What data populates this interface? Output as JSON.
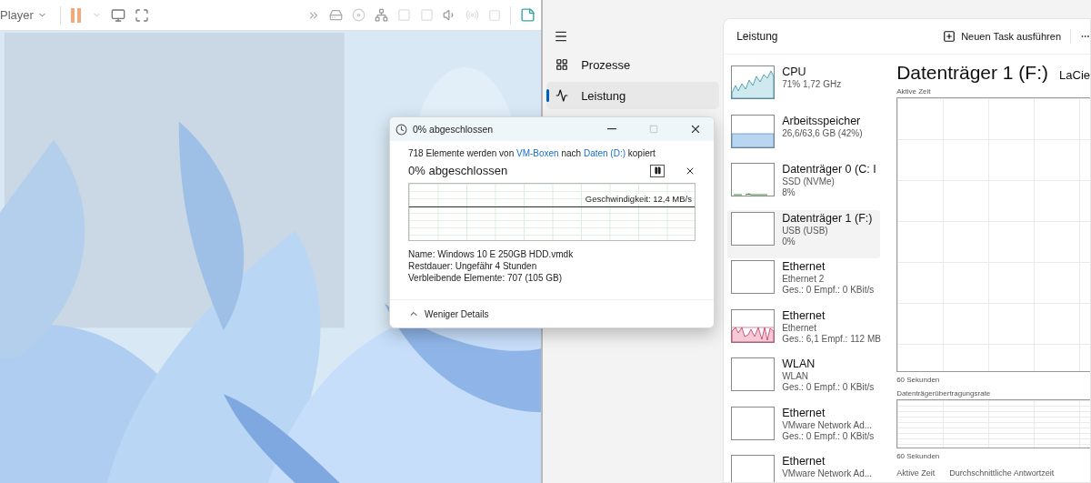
{
  "player": {
    "menu": "Player"
  },
  "task_manager": {
    "nav": [
      {
        "label": "Prozesse",
        "selected": false
      },
      {
        "label": "Leistung",
        "selected": true
      }
    ],
    "header": {
      "title": "Leistung",
      "new_task": "Neuen Task ausführen"
    },
    "devices": [
      {
        "name": "CPU",
        "lines": [
          "71% 1,72 GHz"
        ],
        "kind": "cpu",
        "selected": false
      },
      {
        "name": "Arbeitsspeicher",
        "lines": [
          "26,6/63,6 GB (42%)"
        ],
        "kind": "memory",
        "selected": false
      },
      {
        "name": "Datenträger 0 (C: I",
        "lines": [
          "SSD (NVMe)",
          "8%"
        ],
        "kind": "disk",
        "selected": false
      },
      {
        "name": "Datenträger 1 (F:)",
        "lines": [
          "USB (USB)",
          "0%"
        ],
        "kind": "empty",
        "selected": true
      },
      {
        "name": "Ethernet",
        "lines": [
          "Ethernet 2",
          "Ges.: 0 Empf.: 0 KBit/s"
        ],
        "kind": "empty",
        "selected": false
      },
      {
        "name": "Ethernet",
        "lines": [
          "Ethernet",
          "Ges.: 6,1 Empf.: 112 MB"
        ],
        "kind": "network",
        "selected": false
      },
      {
        "name": "WLAN",
        "lines": [
          "WLAN",
          "Ges.: 0 Empf.: 0 KBit/s"
        ],
        "kind": "empty",
        "selected": false
      },
      {
        "name": "Ethernet",
        "lines": [
          "VMware Network Ad...",
          "Ges.: 0 Empf.: 0 KBit/s"
        ],
        "kind": "empty",
        "selected": false
      },
      {
        "name": "Ethernet",
        "lines": [
          "VMware Network Ad..."
        ],
        "kind": "empty",
        "selected": false
      }
    ],
    "detail": {
      "title": "Datenträger 1 (F:)",
      "model": "LaCie",
      "graph1_label": "Aktive Zeit",
      "graph1_axis": "60 Sekunden",
      "graph2_label": "Datenträgerübertragungsrate",
      "graph2_axis": "60 Sekunden",
      "stats": [
        "Aktive Zeit",
        "Durchschnittliche Antwortzeit"
      ]
    }
  },
  "copy_dialog": {
    "title": "0% abgeschlossen",
    "summary": [
      {
        "kind": "text",
        "text": "718 Elemente werden von "
      },
      {
        "kind": "link",
        "text": "VM-Boxen"
      },
      {
        "kind": "text",
        "text": " nach "
      },
      {
        "kind": "link",
        "text": "Daten (D:)"
      },
      {
        "kind": "text",
        "text": " kopiert"
      }
    ],
    "progress": "0% abgeschlossen",
    "speed": "Geschwindigkeit: 12,4 MB/s",
    "details": [
      "Name: Windows 10 E 250GB HDD.vmdk",
      "Restdauer: Ungefähr 4 Stunden",
      "Verbleibende Elemente: 707 (105 GB)"
    ],
    "toggle": "Weniger Details"
  }
}
